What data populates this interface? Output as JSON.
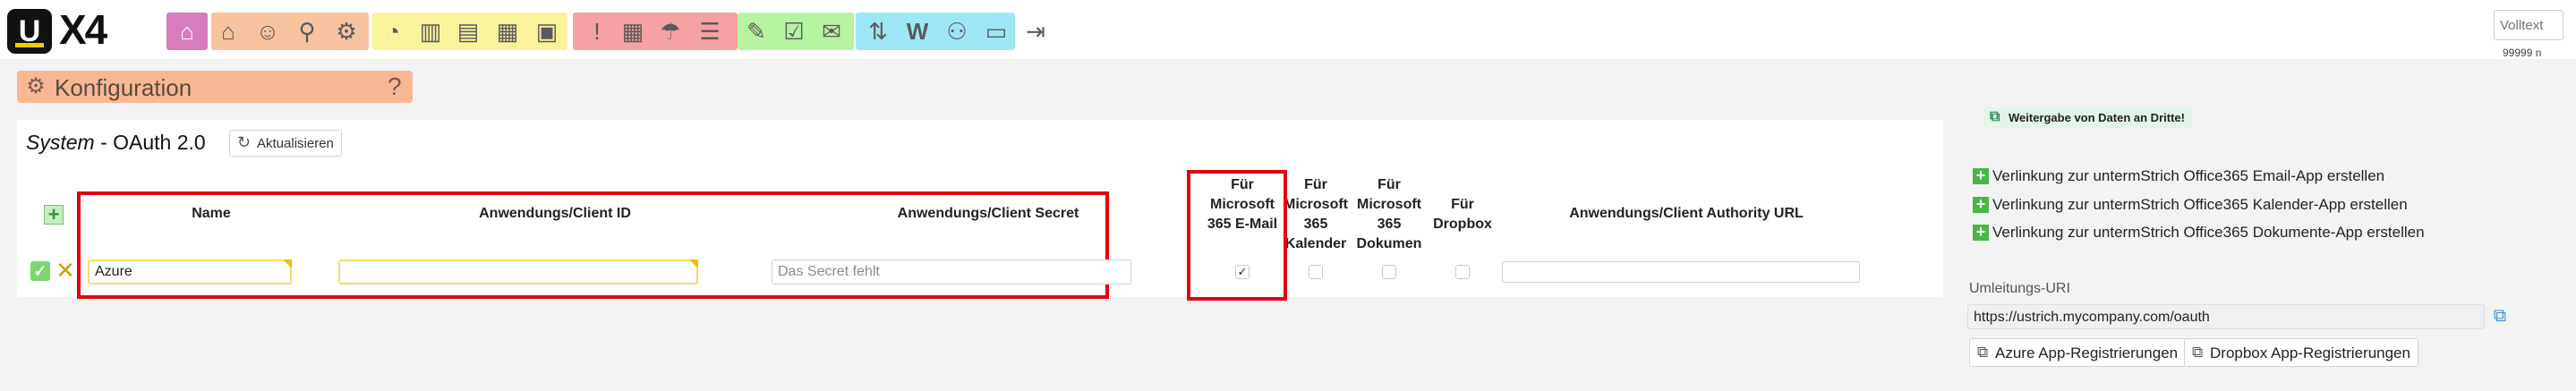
{
  "topbar": {
    "logo_letter": "U",
    "logo_product": "X4",
    "search_placeholder": "Volltext",
    "user_number": "99999 n",
    "icons": [
      "inbox-icon",
      "home-icon",
      "user-icon",
      "location-pin-icon",
      "gear-icon",
      "pie-chart-icon",
      "chart-search-icon",
      "chart-filter-icon",
      "bar-chart-icon",
      "calculator-icon",
      "exclamation-icon",
      "calendar-grid-icon",
      "pin-umbrella-icon",
      "gantt-icon",
      "pencil-icon",
      "checklist-icon",
      "mail-icon",
      "sort-icon",
      "w-icon",
      "user-settings-icon",
      "monitor-icon",
      "logout-icon"
    ],
    "colors": {
      "magenta": "#d77cbc",
      "orange": "#f9c39f",
      "yellow": "#f9f49b",
      "red": "#f6a1a4",
      "green": "#b6f49f",
      "cyan": "#9ee8f6"
    }
  },
  "header": {
    "title": "Konfiguration",
    "help_symbol": "?",
    "color": "#f9b893"
  },
  "section": {
    "title_italic": "System",
    "title_rest": " - OAuth 2.0",
    "refresh_label": "Aktualisieren"
  },
  "table": {
    "columns": {
      "name": "Name",
      "client_id": "Anwendungs/Client ID",
      "client_secret": "Anwendungs/Client Secret",
      "email": "Für Microsoft 365 E-Mail",
      "calendar": "Für Microsoft 365 Kalender",
      "documents": "Für Microsoft 365 Dokumen",
      "dropbox": "Für Dropbox",
      "authority_url": "Anwendungs/Client Authority URL"
    },
    "row": {
      "name": "Azure",
      "client_id": "",
      "client_secret": "",
      "client_secret_placeholder": "Das Secret fehlt",
      "email_checked": true,
      "calendar_checked": false,
      "documents_checked": false,
      "dropbox_checked": false,
      "authority_url": ""
    },
    "highlight_color": "#e3000f"
  },
  "side": {
    "share_label": "Weitergabe von Daten an Dritte!",
    "links": [
      "Verlinkung zur untermStrich Office365 Email-App erstellen",
      "Verlinkung zur untermStrich Office365 Kalender-App erstellen",
      "Verlinkung zur untermStrich Office365 Dokumente-App erstellen"
    ],
    "redirect_label": "Umleitungs-URI",
    "redirect_uri": "https://ustrich.mycompany.com/oauth",
    "azure_btn": "Azure App-Registrierungen",
    "dropbox_btn": "Dropbox App-Registrierungen"
  }
}
